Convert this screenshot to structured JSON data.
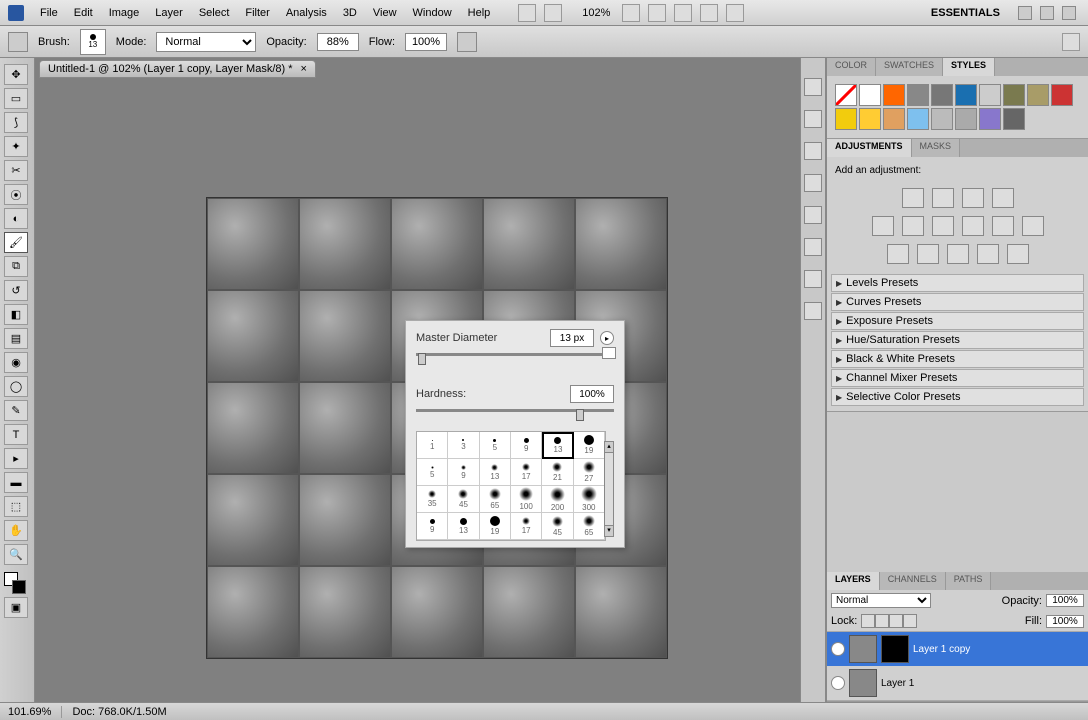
{
  "menubar": [
    "File",
    "Edit",
    "Image",
    "Layer",
    "Select",
    "Filter",
    "Analysis",
    "3D",
    "View",
    "Window",
    "Help"
  ],
  "zoom_top": "102%",
  "workspace": "ESSENTIALS",
  "options": {
    "brush_label": "Brush:",
    "brush_size_small": "13",
    "mode_label": "Mode:",
    "mode_value": "Normal",
    "opacity_label": "Opacity:",
    "opacity_value": "88%",
    "flow_label": "Flow:",
    "flow_value": "100%"
  },
  "doc_tab": "Untitled-1 @ 102% (Layer 1 copy, Layer Mask/8) *",
  "brush_popup": {
    "master_label": "Master Diameter",
    "master_value": "13 px",
    "hardness_label": "Hardness:",
    "hardness_value": "100%",
    "presets": [
      {
        "size": 1,
        "d": 1,
        "type": "hard"
      },
      {
        "size": 3,
        "d": 2,
        "type": "hard"
      },
      {
        "size": 5,
        "d": 3,
        "type": "hard"
      },
      {
        "size": 9,
        "d": 5,
        "type": "hard"
      },
      {
        "size": 13,
        "d": 7,
        "type": "hard",
        "selected": true
      },
      {
        "size": 19,
        "d": 10,
        "type": "hard"
      },
      {
        "size": 5,
        "d": 3,
        "type": "soft"
      },
      {
        "size": 9,
        "d": 5,
        "type": "soft"
      },
      {
        "size": 13,
        "d": 7,
        "type": "soft"
      },
      {
        "size": 17,
        "d": 8,
        "type": "soft"
      },
      {
        "size": 21,
        "d": 10,
        "type": "soft"
      },
      {
        "size": 27,
        "d": 12,
        "type": "soft"
      },
      {
        "size": 35,
        "d": 8,
        "type": "soft"
      },
      {
        "size": 45,
        "d": 10,
        "type": "soft"
      },
      {
        "size": 65,
        "d": 12,
        "type": "soft"
      },
      {
        "size": 100,
        "d": 14,
        "type": "soft"
      },
      {
        "size": 200,
        "d": 15,
        "type": "soft"
      },
      {
        "size": 300,
        "d": 16,
        "type": "soft"
      },
      {
        "size": 9,
        "d": 5,
        "type": "hard"
      },
      {
        "size": 13,
        "d": 7,
        "type": "hard"
      },
      {
        "size": 19,
        "d": 10,
        "type": "hard"
      },
      {
        "size": 17,
        "d": 8,
        "type": "soft"
      },
      {
        "size": 45,
        "d": 11,
        "type": "soft"
      },
      {
        "size": 65,
        "d": 12,
        "type": "soft"
      }
    ]
  },
  "styles_colors": [
    "#ffffff",
    "#ff6600",
    "#888888",
    "#777777",
    "#1a6fb0",
    "#cccccc",
    "#7a7a4f",
    "#a89c68",
    "#cc3333",
    "#f2cc0d",
    "#ffcc33",
    "#e0a060",
    "#7ec0ee",
    "#bbbbbb",
    "#aaaaaa",
    "#8877cc",
    "#666666"
  ],
  "panels": {
    "color_tab": "COLOR",
    "swatches_tab": "SWATCHES",
    "styles_tab": "STYLES",
    "adjustments_tab": "ADJUSTMENTS",
    "masks_tab": "MASKS",
    "add_adj_text": "Add an adjustment:",
    "presets": [
      "Levels Presets",
      "Curves Presets",
      "Exposure Presets",
      "Hue/Saturation Presets",
      "Black & White Presets",
      "Channel Mixer Presets",
      "Selective Color Presets"
    ],
    "layers_tab": "LAYERS",
    "channels_tab": "CHANNELS",
    "paths_tab": "PATHS",
    "blend_mode": "Normal",
    "opacity_label": "Opacity:",
    "opacity_value": "100%",
    "lock_label": "Lock:",
    "fill_label": "Fill:",
    "fill_value": "100%",
    "layer1copy": "Layer 1 copy",
    "layer1": "Layer 1"
  },
  "status": {
    "zoom": "101.69%",
    "doc": "Doc: 768.0K/1.50M"
  }
}
